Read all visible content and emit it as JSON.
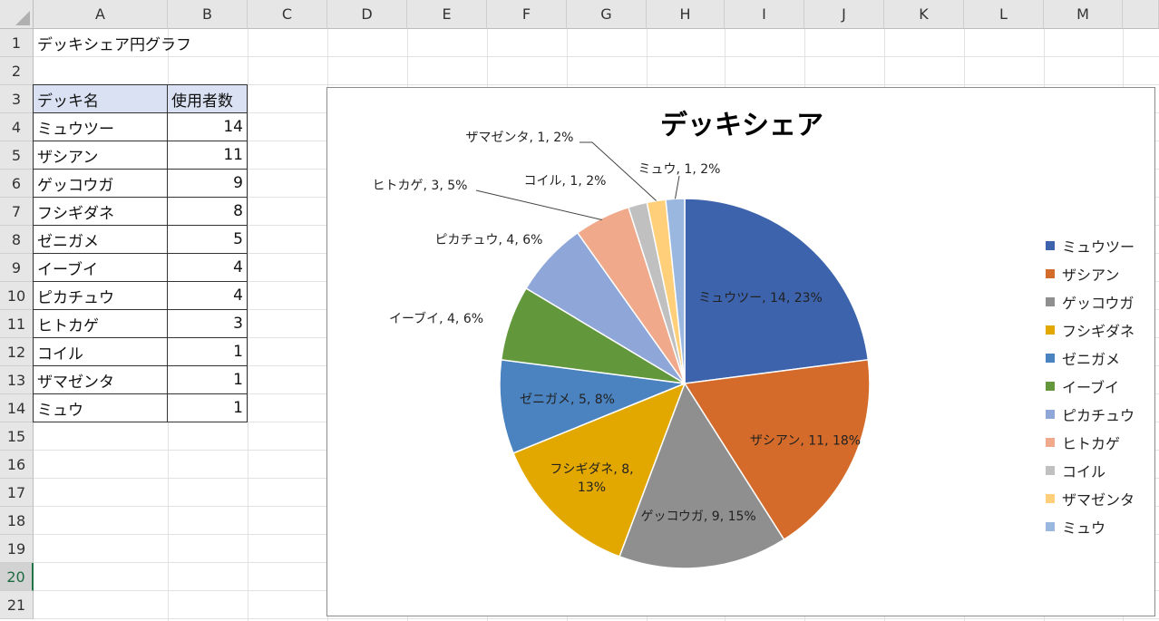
{
  "spreadsheet": {
    "columns": [
      "A",
      "B",
      "C",
      "D",
      "E",
      "F",
      "G",
      "H",
      "I",
      "J",
      "K",
      "L",
      "M"
    ],
    "rows": [
      "1",
      "2",
      "3",
      "4",
      "5",
      "6",
      "7",
      "8",
      "9",
      "10",
      "11",
      "12",
      "13",
      "14",
      "15",
      "16",
      "17",
      "18",
      "19",
      "20",
      "21"
    ],
    "selected_row": "20",
    "a1_title": "デッキシェア円グラフ",
    "table": {
      "headers": [
        "デッキ名",
        "使用者数"
      ],
      "rows": [
        [
          "ミュウツー",
          "14"
        ],
        [
          "ザシアン",
          "11"
        ],
        [
          "ゲッコウガ",
          "9"
        ],
        [
          "フシギダネ",
          "8"
        ],
        [
          "ゼニガメ",
          "5"
        ],
        [
          "イーブイ",
          "4"
        ],
        [
          "ピカチュウ",
          "4"
        ],
        [
          "ヒトカゲ",
          "3"
        ],
        [
          "コイル",
          "1"
        ],
        [
          "ザマゼンタ",
          "1"
        ],
        [
          "ミュウ",
          "1"
        ]
      ]
    }
  },
  "chart_data": {
    "type": "pie",
    "title": "デッキシェア",
    "categories": [
      "ミュウツー",
      "ザシアン",
      "ゲッコウガ",
      "フシギダネ",
      "ゼニガメ",
      "イーブイ",
      "ピカチュウ",
      "ヒトカゲ",
      "コイル",
      "ザマゼンタ",
      "ミュウ"
    ],
    "values": [
      14,
      11,
      9,
      8,
      5,
      4,
      4,
      3,
      1,
      1,
      1
    ],
    "percent_labels": [
      "23%",
      "18%",
      "15%",
      "13%",
      "8%",
      "6%",
      "6%",
      "5%",
      "2%",
      "2%",
      "2%"
    ],
    "data_labels": [
      "ミュウツー, 14, 23%",
      "ザシアン, 11, 18%",
      "ゲッコウガ, 9, 15%",
      "フシギダネ, 8, 13%",
      "ゼニガメ, 5, 8%",
      "イーブイ, 4, 6%",
      "ピカチュウ, 4, 6%",
      "ヒトカゲ, 3, 5%",
      "コイル, 1, 2%",
      "ザマゼンタ, 1, 2%",
      "ミュウ, 1, 2%"
    ],
    "colors": [
      "#3c63ac",
      "#d46b2a",
      "#8f8f8f",
      "#e3a800",
      "#4a83c0",
      "#62983b",
      "#8fa6d8",
      "#f0a98a",
      "#c0c0c0",
      "#ffcf7a",
      "#9ab7e0"
    ],
    "legend_position": "right"
  }
}
